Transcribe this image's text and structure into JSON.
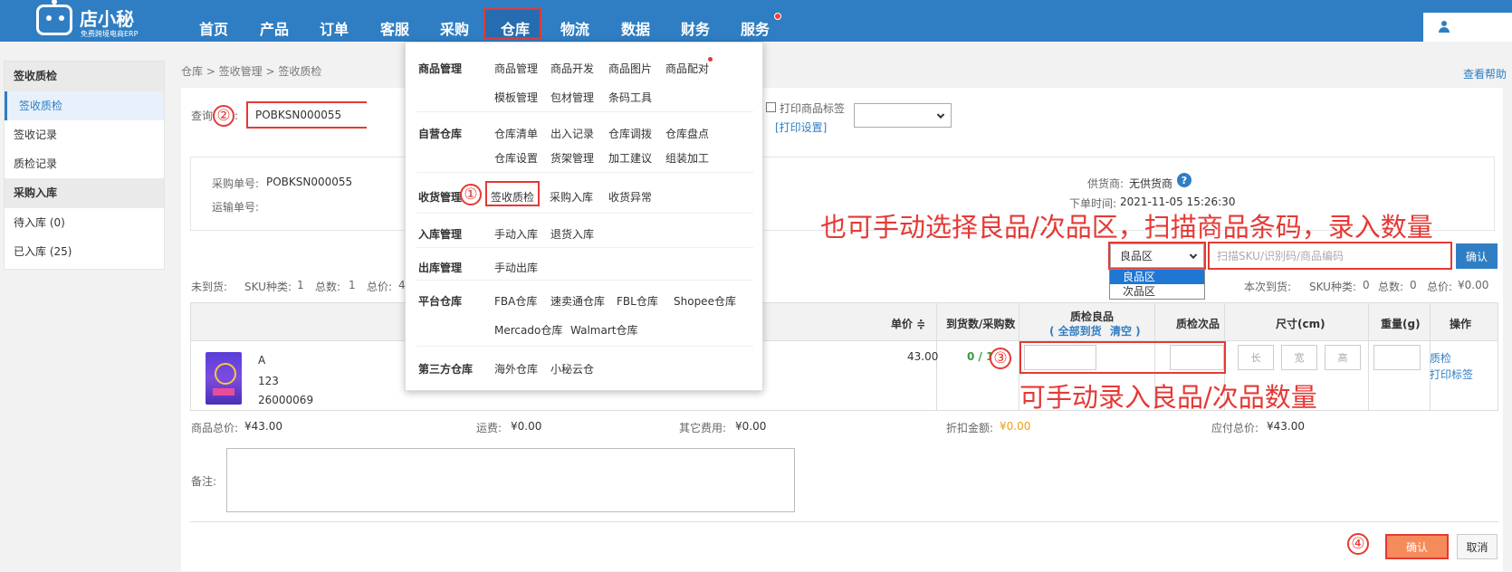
{
  "header": {
    "logo_name": "店小秘",
    "logo_sub": "免费跨境电商ERP",
    "nav": [
      "首页",
      "产品",
      "订单",
      "客服",
      "采购",
      "仓库",
      "物流",
      "数据",
      "财务",
      "服务"
    ],
    "active_nav": "仓库"
  },
  "sidebar": {
    "group1_title": "签收质检",
    "group1_items": [
      "签收质检",
      "签收记录",
      "质检记录"
    ],
    "group2_title": "采购入库",
    "group2_items": [
      "待入库 (0)",
      "已入库 (25)"
    ]
  },
  "breadcrumb": "仓库 > 签收管理 > 签收质检",
  "help_link": "查看帮助",
  "query": {
    "label": "查询单号:",
    "value": "POBKSN000055",
    "print_label": "打印商品标签",
    "print_settings": "[打印设置]"
  },
  "info": {
    "po_label": "采购单号:",
    "po_value": "POBKSN000055",
    "ship_label": "运输单号:",
    "supplier_label": "供货商:",
    "supplier_value": "无供货商",
    "order_time_label": "下单时间:",
    "order_time_value": "2021-11-05 15:26:30"
  },
  "scan": {
    "zone_selected": "良品区",
    "zone_options": [
      "良品区",
      "次品区"
    ],
    "placeholder": "扫描SKU/识别码/商品编码",
    "confirm": "确认"
  },
  "summary_left": {
    "not_arrived_label": "未到货:",
    "sku_kinds_label": "SKU种类:",
    "sku_kinds": "1",
    "total_label": "总数:",
    "total": "1",
    "total_price_label": "总价:",
    "total_price": "43"
  },
  "summary_right": {
    "this_arrival_label": "本次到货:",
    "sku_kinds_label": "SKU种类:",
    "sku_kinds": "0",
    "total_label": "总数:",
    "total": "0",
    "total_price_label": "总价:",
    "total_price": "¥0.00"
  },
  "table": {
    "headers": {
      "unit_price": "单价 ≑",
      "arrived": "到货数/采购数",
      "qc_good": "质检良品",
      "all_arrived": "( 全部到货",
      "clear": "清空 )",
      "qc_bad": "质检次品",
      "size": "尺寸(cm)",
      "weight": "重量(g)",
      "action": "操作"
    },
    "row": {
      "name": "A",
      "code": "123",
      "sku": "26000069",
      "unit_price": "43.00",
      "arrived": "0 / 1",
      "length": "长",
      "width": "宽",
      "height": "高",
      "action_qc": "质检",
      "action_print": "打印标签"
    }
  },
  "totals": {
    "goods_label": "商品总价:",
    "goods_value": "¥43.00",
    "freight_label": "运费:",
    "freight_value": "¥0.00",
    "other_label": "其它费用:",
    "other_value": "¥0.00",
    "discount_label": "折扣金额:",
    "discount_value": "¥0.00",
    "payable_label": "应付总价:",
    "payable_value": "¥43.00"
  },
  "remark_label": "备注:",
  "buttons": {
    "confirm": "确认",
    "cancel": "取消"
  },
  "annotations": {
    "top": "也可手动选择良品/次品区，扫描商品条码，录入数量",
    "bottom": "可手动录入良品/次品数量",
    "n1": "①",
    "n2": "②",
    "n3": "③",
    "n4": "④"
  },
  "mega_menu": {
    "sections": [
      {
        "title": "商品管理",
        "rows": [
          [
            "商品管理",
            "商品开发",
            "商品图片",
            "商品配对"
          ],
          [
            "模板管理",
            "包材管理",
            "条码工具"
          ]
        ]
      },
      {
        "title": "自营仓库",
        "rows": [
          [
            "仓库清单",
            "出入记录",
            "仓库调拨",
            "仓库盘点"
          ],
          [
            "仓库设置",
            "货架管理",
            "加工建议",
            "组装加工"
          ]
        ]
      },
      {
        "title": "收货管理",
        "rows": [
          [
            "签收质检",
            "采购入库",
            "收货异常"
          ]
        ]
      },
      {
        "title": "入库管理",
        "rows": [
          [
            "手动入库",
            "退货入库"
          ]
        ]
      },
      {
        "title": "出库管理",
        "rows": [
          [
            "手动出库"
          ]
        ]
      },
      {
        "title": "平台仓库",
        "rows": [
          [
            "FBA仓库",
            "速卖通仓库",
            "FBL仓库",
            "Shopee仓库"
          ],
          [
            "Mercado仓库",
            "Walmart仓库"
          ]
        ]
      },
      {
        "title": "第三方仓库",
        "rows": [
          [
            "海外仓库",
            "小秘云仓"
          ]
        ]
      }
    ]
  }
}
